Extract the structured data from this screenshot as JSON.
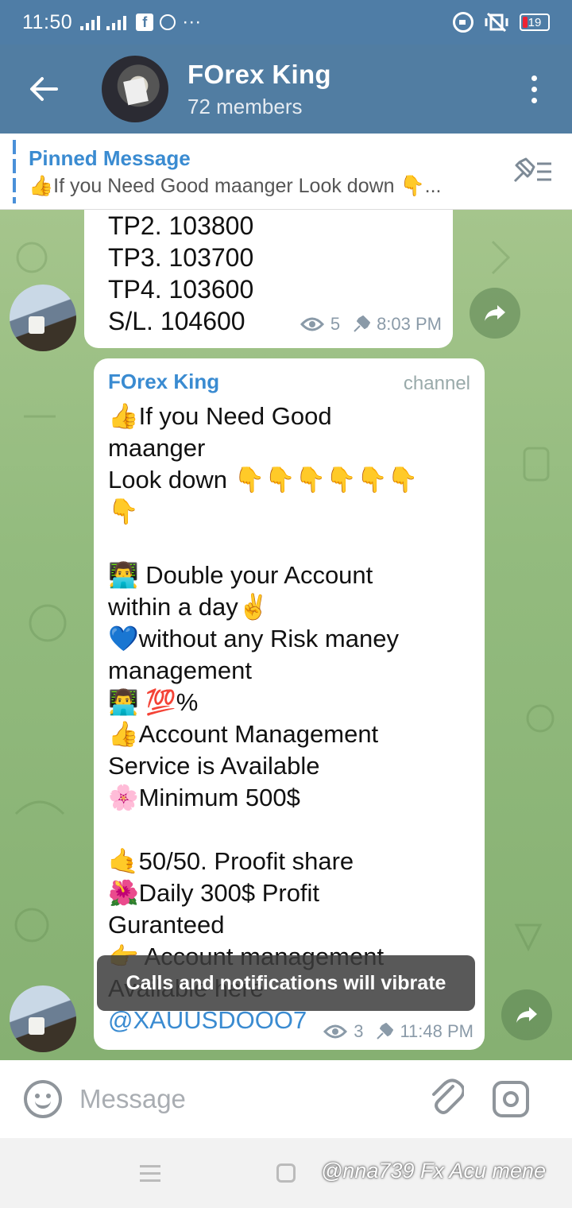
{
  "status_bar": {
    "time": "11:50",
    "notif_facebook": "f",
    "more": "···",
    "battery": "19",
    "battery_color": "#e22233"
  },
  "header": {
    "title": "FOrex King",
    "subtitle": "72 members",
    "bg_color": "#517da2"
  },
  "pinned": {
    "label": "Pinned Message",
    "text": "👍If you Need Good maanger Look down 👇..."
  },
  "messages": [
    {
      "lines": [
        "TP2. 103800",
        "TP3. 103700",
        "TP4. 103600",
        "S/L.  104600"
      ],
      "views": "5",
      "time": "8:03 PM"
    },
    {
      "sender": "FOrex King",
      "tag": "channel",
      "body": "👍If you Need Good\nmaanger\nLook down 👇👇👇👇👇👇\n👇\n\n👨‍💻 Double your Account\nwithin a day✌️\n💙without any  Risk maney\nmanagement\n👨‍💻  💯%\n👍Account Management\nService is Available\n🌸Minimum 500$\n\n🤙50/50. Proofit share\n🌺Daily 300$ Profit\nGuranteed\n👉 Account management\nAvailable here",
      "link": "@XAUUSDOOO7",
      "views": "3",
      "time": "11:48 PM"
    }
  ],
  "toast": "Calls and notifications will vibrate",
  "input": {
    "placeholder": "Message"
  },
  "watermark": "@nna739 Fx Acu mene"
}
